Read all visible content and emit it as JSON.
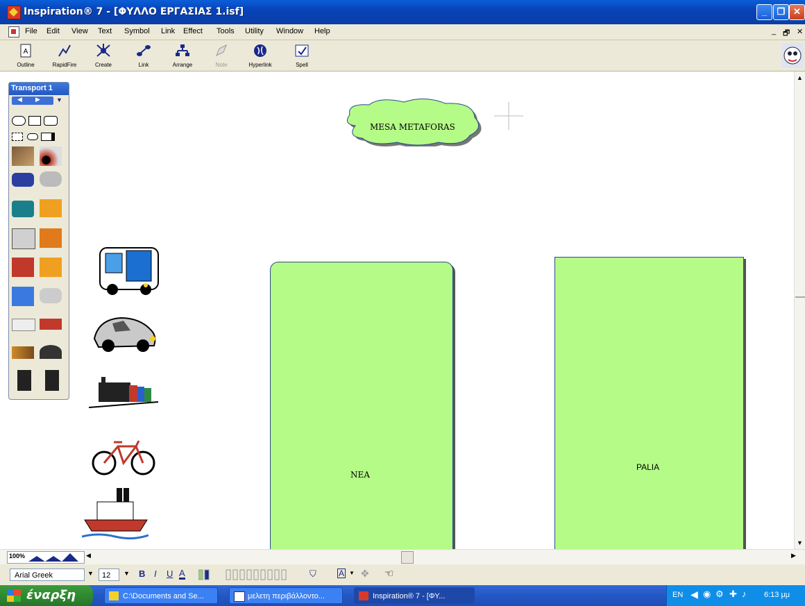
{
  "window": {
    "title": "Inspiration® 7 - [ΦΥΛΛΟ ΕΡΓΑΣΙΑΣ 1.isf]"
  },
  "menu": [
    "File",
    "Edit",
    "View",
    "Text",
    "Symbol",
    "Link",
    "Effect",
    "Tools",
    "Utility",
    "Window",
    "Help"
  ],
  "toolbar": {
    "outline": "Outline",
    "rapidfire": "RapidFire",
    "create": "Create",
    "link": "Link",
    "arrange": "Arrange",
    "note": "Note",
    "hyperlink": "Hyperlink",
    "spell": "Spell"
  },
  "palette": {
    "title": "Transport 1"
  },
  "diagram": {
    "main_idea": "MESA METAFORAS",
    "left_box": "NEA",
    "right_box": "PALIA"
  },
  "status": {
    "zoom": "100%"
  },
  "format": {
    "font": "Arial Greek",
    "size": "12",
    "bold": "B",
    "italic": "I",
    "underline": "U",
    "color": "A",
    "text_btn": "A"
  },
  "taskbar": {
    "start": "έναρξη",
    "tasks": [
      "C:\\Documents and Se...",
      "μελετη περιβάλλοντο...",
      "Inspiration® 7 - [ΦΥ..."
    ],
    "lang": "EN",
    "clock": "6:13 μμ"
  },
  "colors": {
    "box_fill": "#b5fb87",
    "title_bar": "#0a5fd8",
    "taskbar": "#2457c4",
    "start": "#2f8a2f"
  }
}
